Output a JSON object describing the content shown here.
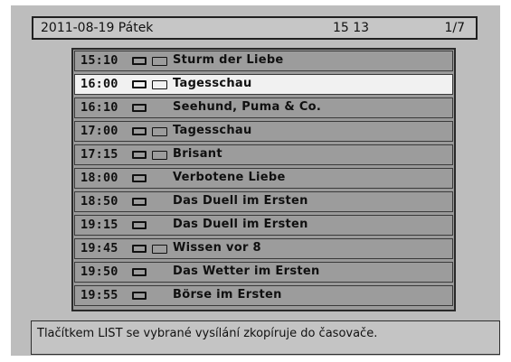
{
  "header": {
    "date": "2011-08-19 Pátek",
    "time": "15 13",
    "page": "1/7"
  },
  "programs": [
    {
      "time": "15:10",
      "title": "Sturm der Liebe",
      "teletext": true,
      "selected": false
    },
    {
      "time": "16:00",
      "title": "Tagesschau",
      "teletext": true,
      "selected": true
    },
    {
      "time": "16:10",
      "title": "Seehund, Puma & Co.",
      "teletext": false,
      "selected": false
    },
    {
      "time": "17:00",
      "title": "Tagesschau",
      "teletext": true,
      "selected": false
    },
    {
      "time": "17:15",
      "title": "Brisant",
      "teletext": true,
      "selected": false
    },
    {
      "time": "18:00",
      "title": "Verbotene Liebe",
      "teletext": false,
      "selected": false
    },
    {
      "time": "18:50",
      "title": "Das Duell im Ersten",
      "teletext": false,
      "selected": false
    },
    {
      "time": "19:15",
      "title": "Das Duell im Ersten",
      "teletext": false,
      "selected": false
    },
    {
      "time": "19:45",
      "title": "Wissen vor 8",
      "teletext": true,
      "selected": false
    },
    {
      "time": "19:50",
      "title": "Das Wetter im Ersten",
      "teletext": false,
      "selected": false
    },
    {
      "time": "19:55",
      "title": "Börse im Ersten",
      "teletext": false,
      "selected": false
    }
  ],
  "footer": {
    "hint": "Tlačítkem LIST se vybrané vysílání zkopíruje do časovače."
  },
  "icons": {
    "screen": "tv-screen-icon",
    "teletext": "teletext-icon"
  }
}
